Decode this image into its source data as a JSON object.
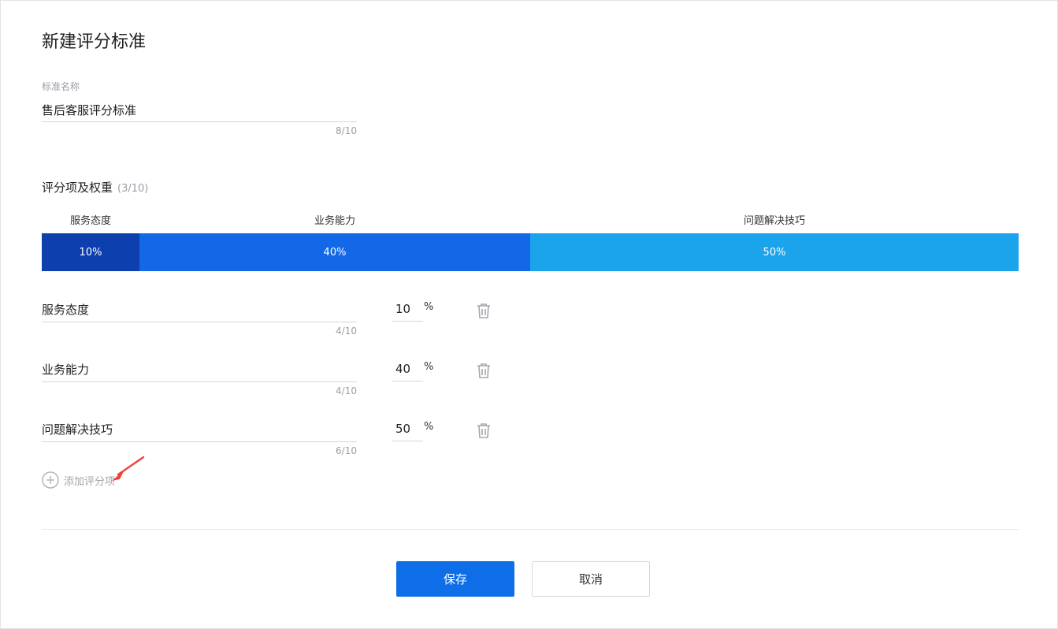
{
  "page_title": "新建评分标准",
  "name_field": {
    "label": "标准名称",
    "value": "售后客服评分标准",
    "counter": "8/10"
  },
  "items_section": {
    "title": "评分项及权重",
    "count": "(3/10)"
  },
  "weight_bar": {
    "segments": [
      {
        "label": "服务态度",
        "percent_text": "10%",
        "value": 10,
        "color": "#0e3fae"
      },
      {
        "label": "业务能力",
        "percent_text": "40%",
        "value": 40,
        "color": "#1268e6"
      },
      {
        "label": "问题解决技巧",
        "percent_text": "50%",
        "value": 50,
        "color": "#1ba3ec"
      }
    ]
  },
  "items": [
    {
      "name": "服务态度",
      "counter": "4/10",
      "weight": "10",
      "unit": "%",
      "icon": "trash-icon"
    },
    {
      "name": "业务能力",
      "counter": "4/10",
      "weight": "40",
      "unit": "%",
      "icon": "trash-icon"
    },
    {
      "name": "问题解决技巧",
      "counter": "6/10",
      "weight": "50",
      "unit": "%",
      "icon": "trash-icon"
    }
  ],
  "add_item": {
    "label": "添加评分项",
    "icon": "plus-circle-icon"
  },
  "actions": {
    "save_label": "保存",
    "cancel_label": "取消"
  },
  "colors": {
    "primary": "#0d6ee8",
    "annotation_arrow": "#f0413a"
  }
}
